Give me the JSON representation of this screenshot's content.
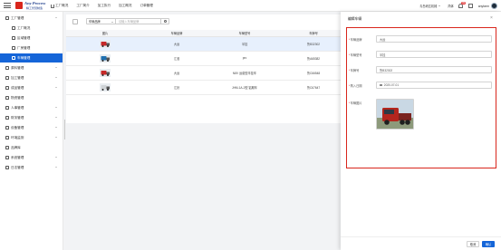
{
  "app": {
    "logo_title": "Any Process",
    "logo_subtitle": "精工智慧制造"
  },
  "header": {
    "nav": [
      "工厂概况",
      "工厂简介",
      "加工执行",
      "加工概况",
      "订单管理"
    ],
    "org": "青岛研达机械",
    "lang": "简体",
    "notification_count": "99",
    "user": "anyfarm"
  },
  "sidebar": {
    "items": [
      {
        "label": "工厂管理",
        "level": 0,
        "expanded": true,
        "active": false
      },
      {
        "label": "工厂概况",
        "level": 1,
        "active": false
      },
      {
        "label": "区域管理",
        "level": 1,
        "active": false
      },
      {
        "label": "厂房管理",
        "level": 1,
        "active": false
      },
      {
        "label": "车辆管理",
        "level": 1,
        "active": true
      },
      {
        "label": "原料管理",
        "level": 0,
        "active": false
      },
      {
        "label": "加工管理",
        "level": 0,
        "active": false
      },
      {
        "label": "成品管理",
        "level": 0,
        "active": false
      },
      {
        "label": "物资管理",
        "level": 0,
        "active": false
      },
      {
        "label": "人事管理",
        "level": 0,
        "active": false
      },
      {
        "label": "财务管理",
        "level": 0,
        "active": false
      },
      {
        "label": "设备管理",
        "level": 0,
        "active": false
      },
      {
        "label": "环境监测",
        "level": 0,
        "active": false
      },
      {
        "label": "品牌库",
        "level": 0,
        "active": false
      },
      {
        "label": "系统管理",
        "level": 0,
        "active": false
      },
      {
        "label": "日志管理",
        "level": 0,
        "active": false
      }
    ]
  },
  "search": {
    "field": "车辆品牌",
    "placeholder": "请输入车辆品牌"
  },
  "table": {
    "columns": [
      "图片",
      "车辆品牌",
      "车辆型号",
      "车牌号"
    ],
    "rows": [
      {
        "brand": "大运",
        "model": "半挂",
        "plate": "鲁B32302",
        "color": "#c62828",
        "selected": true
      },
      {
        "brand": "江淮",
        "model": "pro",
        "plate": "鲁A65382",
        "color": "#1e6fb0",
        "selected": false
      },
      {
        "brand": "大运",
        "model": "N8V 运载型半挂车",
        "plate": "鲁C66548",
        "color": "#c62828",
        "selected": false
      },
      {
        "brand": "江铃",
        "model": "JHM-1A-2型 铝厢车",
        "plate": "鲁C67647",
        "color": "#cfd3d6",
        "selected": false
      }
    ]
  },
  "drawer": {
    "title": "编辑车辆",
    "close": "×",
    "fields": [
      {
        "label": "车辆品牌",
        "value": "大运",
        "required": true
      },
      {
        "label": "车辆型号",
        "value": "半挂",
        "required": true
      },
      {
        "label": "车牌号",
        "value": "鲁B32302",
        "required": true
      },
      {
        "label": "购入日期",
        "value": "2020-07-01",
        "required": true
      }
    ],
    "image_label": "车辆图片",
    "cancel": "取消",
    "ok": "确认"
  }
}
